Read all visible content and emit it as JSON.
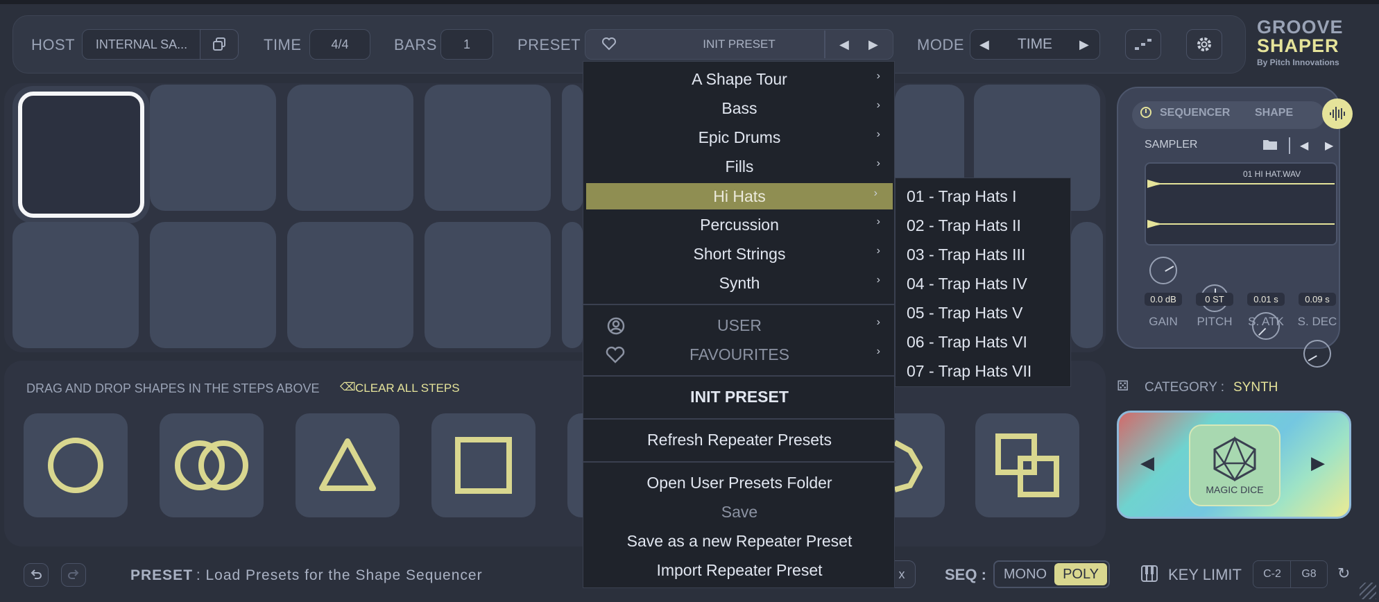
{
  "topbar": {
    "host_label": "HOST",
    "host_value": "INTERNAL SA...",
    "time_label": "TIME",
    "time_value": "4/4",
    "bars_label": "BARS",
    "bars_value": "1",
    "preset_label": "PRESET",
    "preset_value": "INIT PRESET",
    "mode_label": "MODE",
    "mode_value": "TIME"
  },
  "brand": {
    "line1": "GROOVE",
    "line2": "SHAPER",
    "by": "By Pitch Innovations"
  },
  "shapes": {
    "hint": "DRAG AND DROP SHAPES IN THE STEPS ABOVE",
    "clear": "CLEAR ALL STEPS"
  },
  "sampler": {
    "tab1": "SEQUENCER",
    "tab2": "SHAPE",
    "label": "SAMPLER",
    "file": "01 HI HAT.WAV",
    "knobs": [
      {
        "value": "0.0 dB",
        "label": "GAIN"
      },
      {
        "value": "0 ST",
        "label": "PITCH"
      },
      {
        "value": "0.01 s",
        "label": "S. ATK"
      },
      {
        "value": "0.09 s",
        "label": "S. DEC"
      }
    ]
  },
  "category": {
    "label": "CATEGORY :",
    "value": "SYNTH",
    "dice": "MAGIC DICE"
  },
  "menu": {
    "items": [
      "A Shape Tour",
      "Bass",
      "Epic Drums",
      "Fills",
      "Hi Hats",
      "Percussion",
      "Short Strings",
      "Synth"
    ],
    "user": "USER",
    "favourites": "FAVOURITES",
    "init": "INIT PRESET",
    "refresh": "Refresh Repeater Presets",
    "open_folder": "Open User Presets Folder",
    "save": "Save",
    "save_new": "Save as a new Repeater Preset",
    "import": "Import Repeater Preset"
  },
  "submenu": {
    "items": [
      "01 - Trap Hats I",
      "02 - Trap Hats II",
      "03 - Trap Hats III",
      "04 - Trap Hats IV",
      "05 - Trap Hats V",
      "06 - Trap Hats VI",
      "07 - Trap Hats VII"
    ]
  },
  "bottom": {
    "status_bold": "PRESET",
    "status_text": " : Load Presets for the Shape Sequencer",
    "fx": "x",
    "seq_label": "SEQ :",
    "mono": "MONO",
    "poly": "POLY",
    "key_limit": "KEY LIMIT",
    "key_low": "C-2",
    "key_high": "G8"
  },
  "colors": {
    "accent": "#e5e39a",
    "highlight": "#8f8e52",
    "panel": "#2f3442",
    "pad": "#414a5d"
  }
}
